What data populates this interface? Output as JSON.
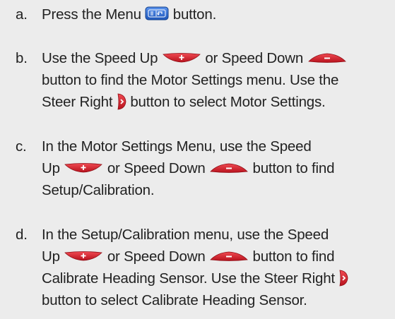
{
  "steps": [
    {
      "marker": "a.",
      "lines": [
        {
          "t1": "Press the Menu",
          "t2": "button."
        }
      ]
    },
    {
      "marker": "b.",
      "lines": [
        {
          "t1": "Use the Speed Up",
          "t2": "or Speed Down"
        },
        {
          "t1": "button to find the Motor Settings menu. Use the"
        },
        {
          "t1": "Steer Right",
          "t2": "button to select Motor Settings."
        }
      ]
    },
    {
      "marker": "c.",
      "lines": [
        {
          "t1": "In the Motor Settings Menu, use the Speed"
        },
        {
          "t1": "Up",
          "t2": "or Speed Down",
          "t3": "button to find"
        },
        {
          "t1": "Setup/Calibration."
        }
      ]
    },
    {
      "marker": "d.",
      "lines": [
        {
          "t1": "In the Setup/Calibration menu, use the Speed"
        },
        {
          "t1": "Up",
          "t2": "or Speed Down",
          "t3": "button to find"
        },
        {
          "t1": "Calibrate Heading Sensor. Use the Steer Right"
        },
        {
          "t1": "button to select Calibrate Heading Sensor."
        }
      ]
    }
  ],
  "icons": {
    "menu": "menu-button-icon",
    "speed_up": "speed-up-button-icon",
    "speed_down": "speed-down-button-icon",
    "steer_right": "steer-right-button-icon"
  },
  "colors": {
    "background": "#ececec",
    "text": "#222222",
    "menu_blue": "#2f6fd6",
    "button_red": "#d51f2b"
  }
}
